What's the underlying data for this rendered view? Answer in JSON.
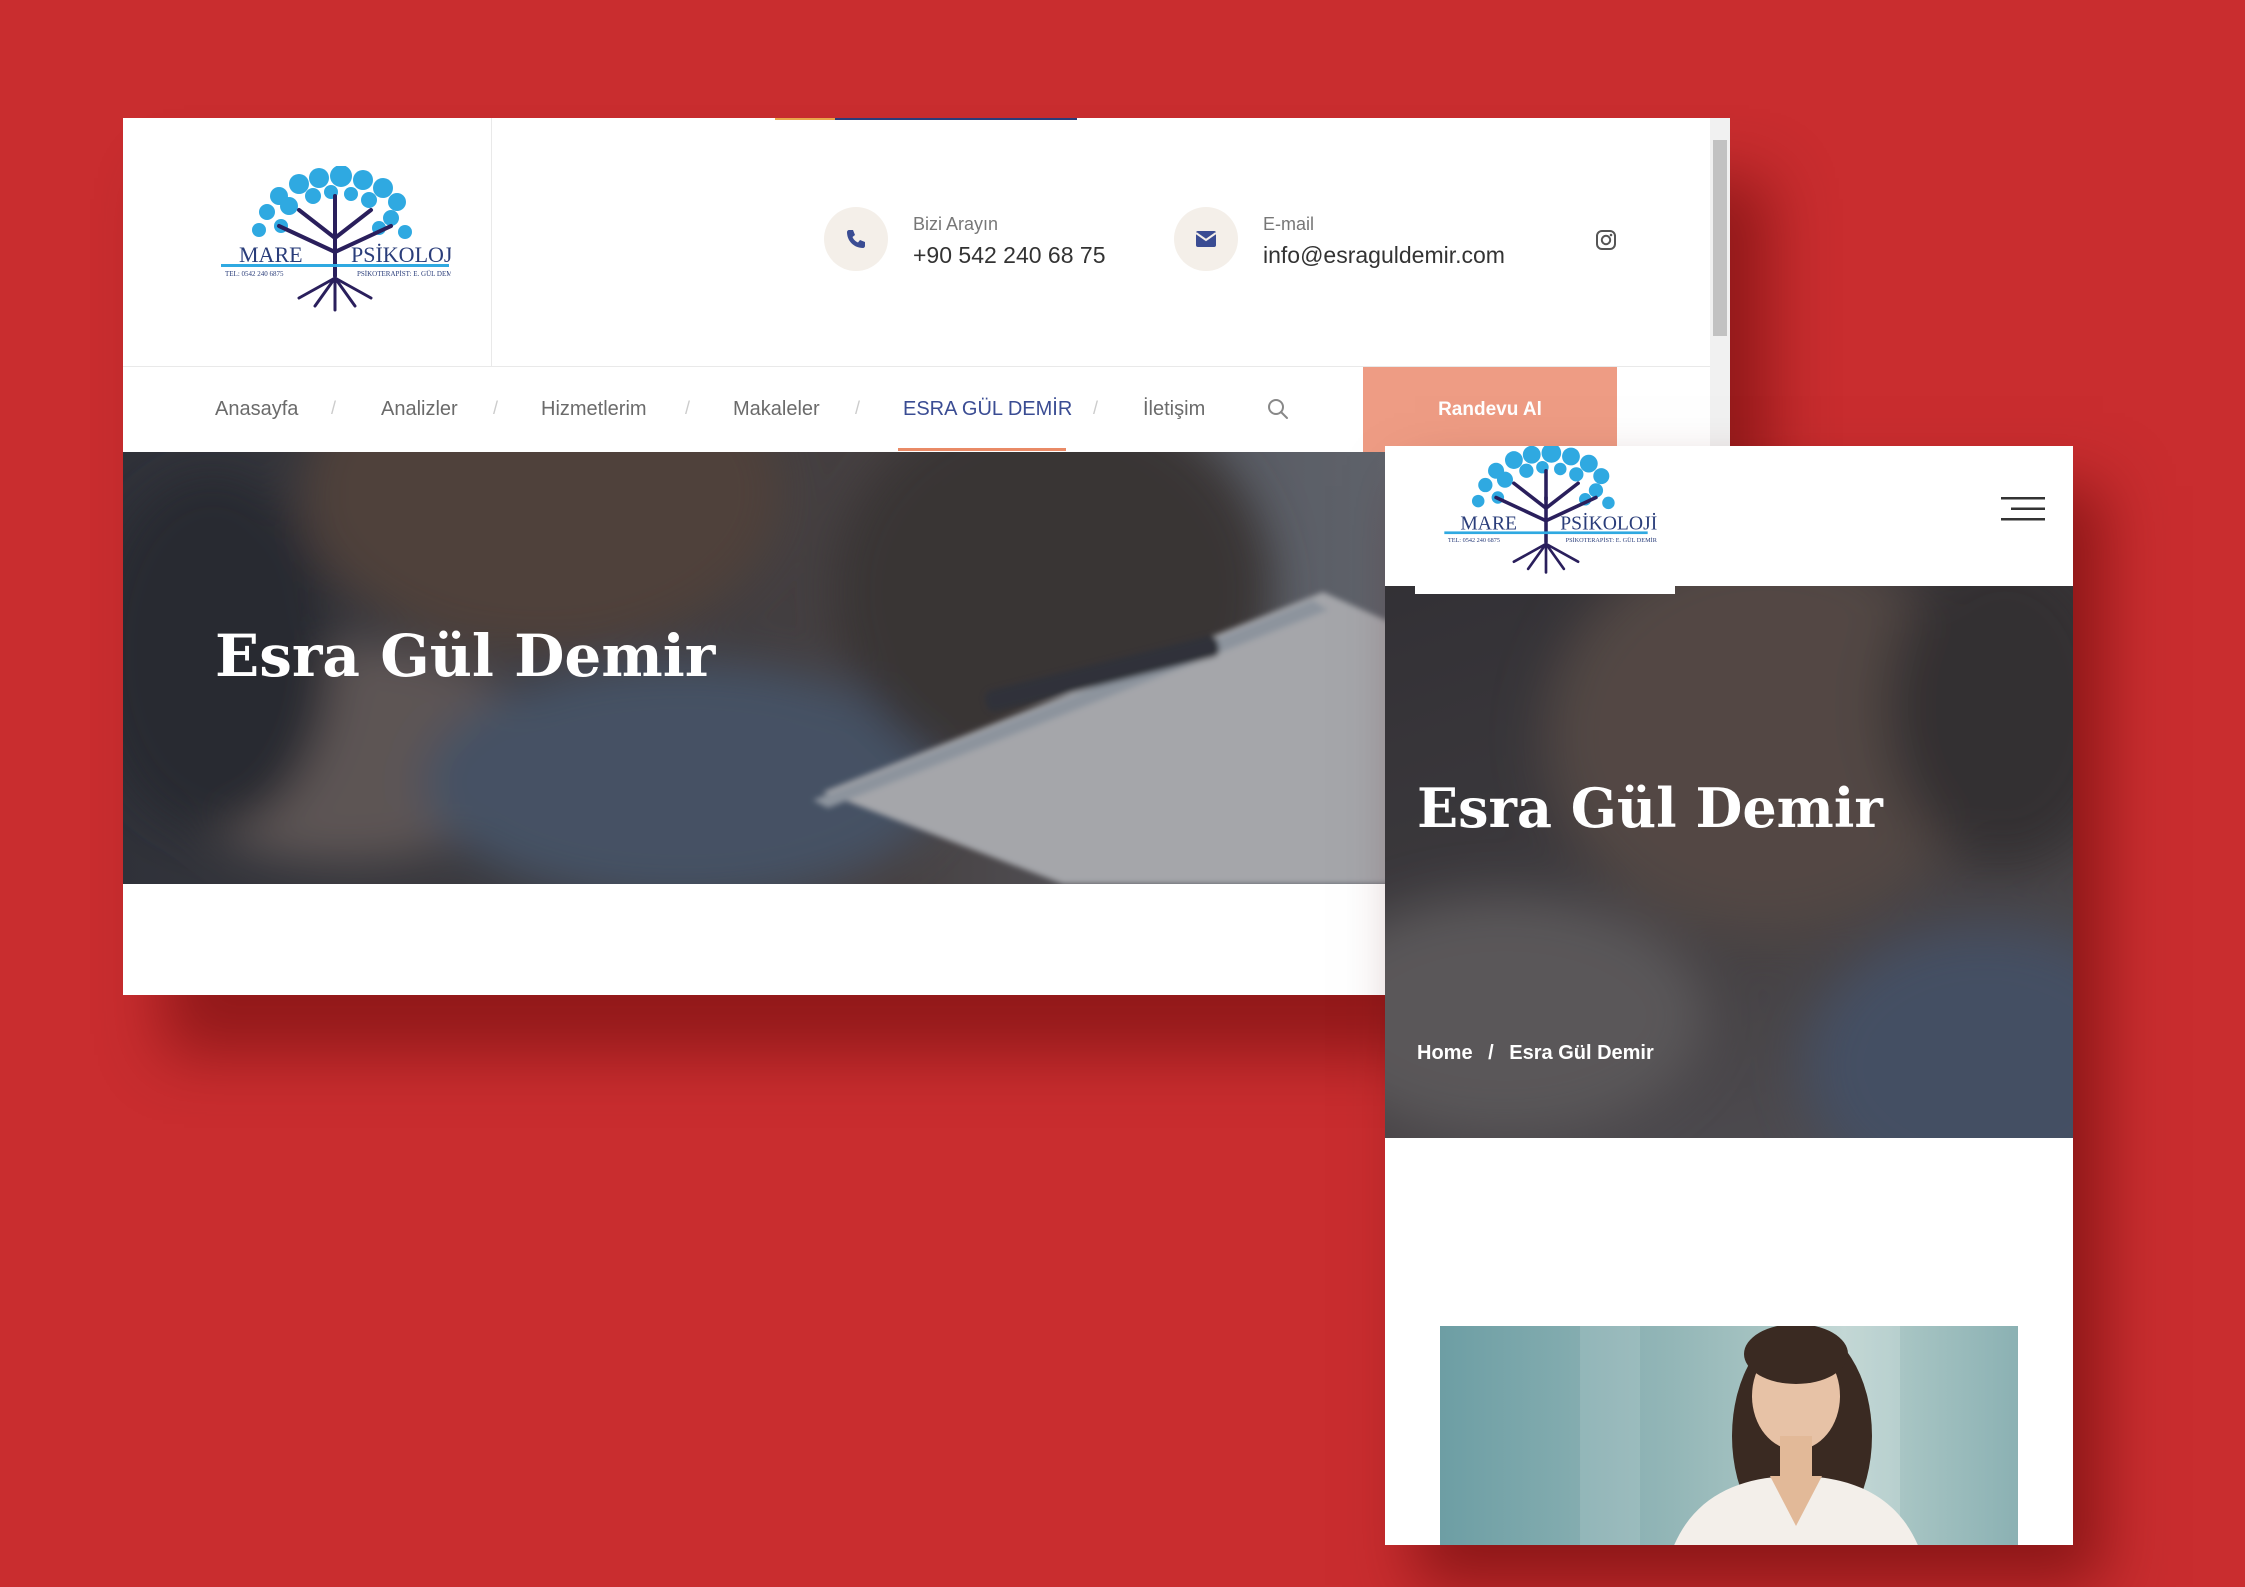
{
  "desktop": {
    "logo": {
      "text": "MARE PSİKOLOJİ",
      "sub_left": "TEL: 0542 240 6875",
      "sub_right": "PSİKOTERAPİST: E. GÜL DEMİR"
    },
    "contacts": [
      {
        "icon": "phone-icon",
        "label": "Bizi Arayın",
        "value": "+90 542 240 68 75"
      },
      {
        "icon": "mail-icon",
        "label": "E-mail",
        "value": "info@esraguldemir.com"
      }
    ],
    "social_icon": "instagram-icon",
    "nav": {
      "items": [
        "Anasayfa",
        "Analizler",
        "Hizmetlerim",
        "Makaleler",
        "ESRA GÜL DEMİR",
        "İletişim"
      ],
      "active_index": 4,
      "separator": "/",
      "search_icon": "search-icon"
    },
    "cta_label": "Randevu Al",
    "hero_title": "Esra Gül Demir"
  },
  "mobile": {
    "menu_icon": "hamburger-icon",
    "hero_title": "Esra Gül Demir",
    "breadcrumb": {
      "home": "Home",
      "separator": "/",
      "current": "Esra Gül Demir"
    }
  },
  "colors": {
    "background": "#c92d2f",
    "accent_blue": "#3a4c93",
    "cta": "#ee9c84",
    "icon_bg": "#f4efe9"
  }
}
